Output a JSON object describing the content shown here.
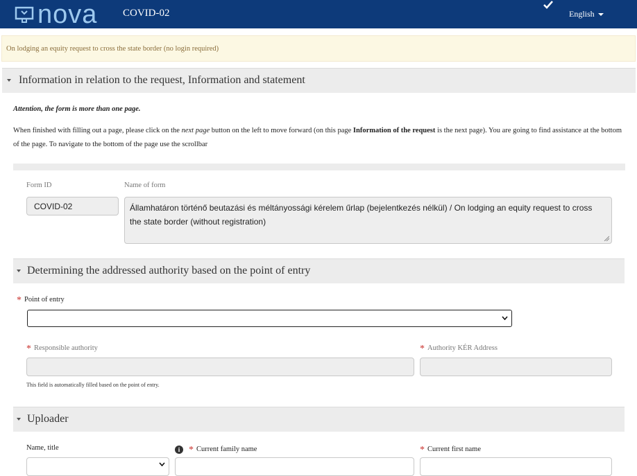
{
  "header": {
    "logo_text": "nova",
    "app_title": "COVID-02",
    "language": "English",
    "colors": {
      "bar": "#0d3a7a",
      "logo": "#9ec9ee"
    }
  },
  "notice": {
    "text": "On lodging an equity request to cross the state border (no login required)"
  },
  "section_info": {
    "title": "Information in relation to the request, Information and statement",
    "attention": "Attention, the form is more than one page.",
    "para_part1": "When finished with filling out a page, please click on the ",
    "para_next_page": "next page",
    "para_part2": " button on the left to move forward (on this page ",
    "para_bold": "Information of the request",
    "para_part3": " is the next page). You are going to find assistance at the bottom of the page. To navigate to the bottom of the page use the scrollbar"
  },
  "form_meta": {
    "form_id_label": "Form ID",
    "form_id_value": "COVID-02",
    "form_name_label": "Name of form",
    "form_name_value": "Államhatáron történő beutazási és méltányossági kérelem űrlap (bejelentkezés nélkül) / On lodging an equity request to cross the state border (without registration)"
  },
  "section_authority": {
    "title": "Determining the addressed authority based on the point of entry",
    "point_of_entry_label": "Point of entry",
    "point_of_entry_value": "",
    "responsible_authority_label": "Responsible authority",
    "authority_ker_label": "Authority KÉR Address",
    "helper_text": "This field is automatically filled based on the point of entry."
  },
  "section_uploader": {
    "title": "Uploader",
    "name_title_label": "Name, title",
    "family_name_label": "Current family name",
    "first_name_label": "Current first name"
  },
  "required_mark": "*"
}
